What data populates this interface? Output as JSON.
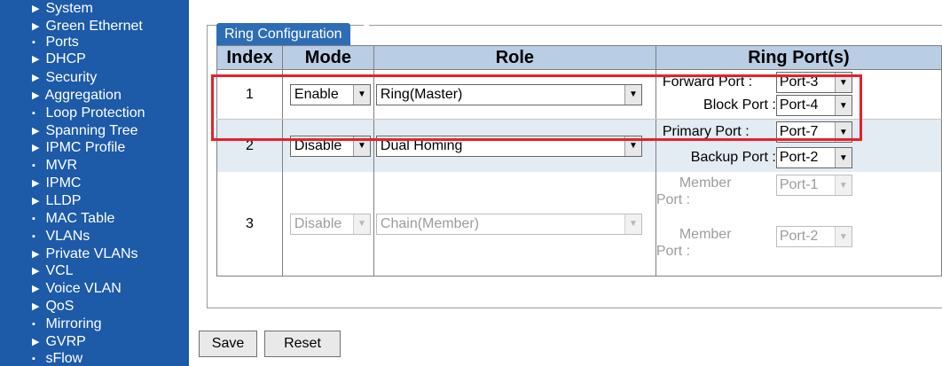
{
  "sidebar": {
    "items": [
      {
        "label": "System",
        "marker": "▶"
      },
      {
        "label": "Green Ethernet",
        "marker": "▶"
      },
      {
        "label": "Ports",
        "marker": "▪"
      },
      {
        "label": "DHCP",
        "marker": "▶"
      },
      {
        "label": "Security",
        "marker": "▶"
      },
      {
        "label": "Aggregation",
        "marker": "▶"
      },
      {
        "label": "Loop Protection",
        "marker": "▪"
      },
      {
        "label": "Spanning Tree",
        "marker": "▶"
      },
      {
        "label": "IPMC Profile",
        "marker": "▶"
      },
      {
        "label": "MVR",
        "marker": "▪"
      },
      {
        "label": "IPMC",
        "marker": "▶"
      },
      {
        "label": "LLDP",
        "marker": "▶"
      },
      {
        "label": "MAC Table",
        "marker": "▪"
      },
      {
        "label": "VLANs",
        "marker": "▪"
      },
      {
        "label": "Private VLANs",
        "marker": "▶"
      },
      {
        "label": "VCL",
        "marker": "▶"
      },
      {
        "label": "Voice VLAN",
        "marker": "▶"
      },
      {
        "label": "QoS",
        "marker": "▶"
      },
      {
        "label": "Mirroring",
        "marker": "▪"
      },
      {
        "label": "GVRP",
        "marker": "▶"
      },
      {
        "label": "sFlow",
        "marker": "▪"
      }
    ]
  },
  "section": {
    "title": "Ring Configuration"
  },
  "table": {
    "headers": {
      "index": "Index",
      "mode": "Mode",
      "role": "Role",
      "ports": "Ring Port(s)"
    },
    "rows": [
      {
        "index": "1",
        "mode": "Enable",
        "role": "Ring(Master)",
        "disabled": false,
        "ports": [
          {
            "label": "Forward Port :",
            "value": "Port-3"
          },
          {
            "label": "Block Port :",
            "value": "Port-4"
          }
        ]
      },
      {
        "index": "2",
        "mode": "Disable",
        "role": "Dual Homing",
        "disabled": false,
        "ports": [
          {
            "label": "Primary Port :",
            "value": "Port-7"
          },
          {
            "label": "Backup Port :",
            "value": "Port-2"
          }
        ]
      },
      {
        "index": "3",
        "mode": "Disable",
        "role": "Chain(Member)",
        "disabled": true,
        "ports": [
          {
            "label_line1": "Member",
            "label_line2": "Port :",
            "value": "Port-1"
          },
          {
            "label_line1": "Member",
            "label_line2": "Port :",
            "value": "Port-2"
          }
        ]
      }
    ]
  },
  "buttons": {
    "save": "Save",
    "reset": "Reset"
  },
  "colors": {
    "sidebar": "#1d5aa8",
    "header": "#b9cde4",
    "row_alt": "#e3ebf3",
    "highlight": "#e3222c"
  }
}
